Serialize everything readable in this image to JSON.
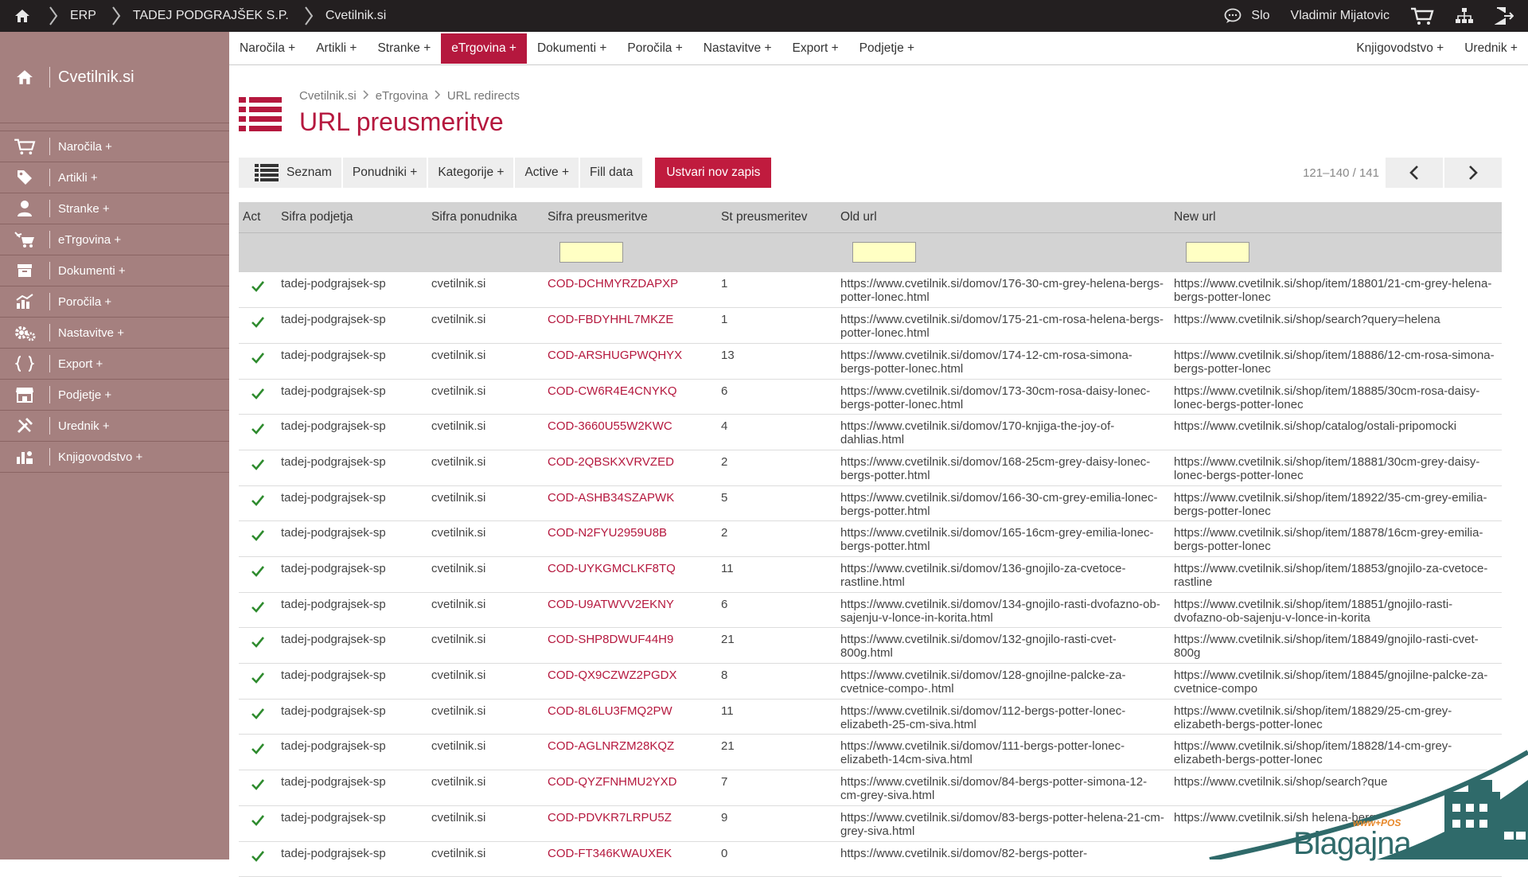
{
  "topbar": {
    "breadcrumb": [
      "ERP",
      "TADEJ PODGRAJŠEK S.P.",
      "Cvetilnik.si"
    ],
    "language": "Slo",
    "user": "Vladimir Mijatovic"
  },
  "sidebar": {
    "title": "Cvetilnik.si",
    "items": [
      {
        "label": "Naročila +",
        "icon": "cart-icon"
      },
      {
        "label": "Artikli +",
        "icon": "tag-icon"
      },
      {
        "label": "Stranke +",
        "icon": "user-icon"
      },
      {
        "label": "eTrgovina +",
        "icon": "ecommerce-icon"
      },
      {
        "label": "Dokumenti +",
        "icon": "documents-icon"
      },
      {
        "label": "Poročila +",
        "icon": "chart-icon"
      },
      {
        "label": "Nastavitve +",
        "icon": "gears-icon"
      },
      {
        "label": "Export +",
        "icon": "export-icon"
      },
      {
        "label": "Podjetje +",
        "icon": "store-icon"
      },
      {
        "label": "Urednik +",
        "icon": "tools-icon"
      },
      {
        "label": "Knjigovodstvo +",
        "icon": "accounting-icon"
      }
    ]
  },
  "menu": {
    "left": [
      "Naročila +",
      "Artikli +",
      "Stranke +",
      "eTrgovina +",
      "Dokumenti +",
      "Poročila +",
      "Nastavitve +",
      "Export +",
      "Podjetje +"
    ],
    "right": [
      "Knjigovodstvo +",
      "Urednik +"
    ],
    "active": "eTrgovina +"
  },
  "page": {
    "breadcrumb": [
      "Cvetilnik.si",
      "eTrgovina",
      "URL redirects"
    ],
    "title": "URL preusmeritve"
  },
  "toolbar": {
    "list": "Seznam",
    "suppliers": "Ponudniki +",
    "categories": "Kategorije +",
    "active": "Active +",
    "fill": "Fill data",
    "create": "Ustvari nov zapis",
    "pager": "121–140 / 141"
  },
  "table": {
    "headers": [
      "Act",
      "Sifra podjetja",
      "Sifra ponudnika",
      "Sifra preusmeritve",
      "St preusmeritev",
      "Old url",
      "New url"
    ],
    "rows": [
      [
        "tadej-podgrajsek-sp",
        "cvetilnik.si",
        "COD-DCHMYRZDAPXP",
        "1",
        "https://www.cvetilnik.si/domov/176-30-cm-grey-helena-bergs-potter-lonec.html",
        "https://www.cvetilnik.si/shop/item/18801/21-cm-grey-helena-bergs-potter-lonec"
      ],
      [
        "tadej-podgrajsek-sp",
        "cvetilnik.si",
        "COD-FBDYHHL7MKZE",
        "1",
        "https://www.cvetilnik.si/domov/175-21-cm-rosa-helena-bergs-potter-lonec.html",
        "https://www.cvetilnik.si/shop/search?query=helena"
      ],
      [
        "tadej-podgrajsek-sp",
        "cvetilnik.si",
        "COD-ARSHUGPWQHYX",
        "13",
        "https://www.cvetilnik.si/domov/174-12-cm-rosa-simona-bergs-potter-lonec.html",
        "https://www.cvetilnik.si/shop/item/18886/12-cm-rosa-simona-bergs-potter-lonec"
      ],
      [
        "tadej-podgrajsek-sp",
        "cvetilnik.si",
        "COD-CW6R4E4CNYKQ",
        "6",
        "https://www.cvetilnik.si/domov/173-30cm-rosa-daisy-lonec-bergs-potter-lonec.html",
        "https://www.cvetilnik.si/shop/item/18885/30cm-rosa-daisy-lonec-bergs-potter-lonec"
      ],
      [
        "tadej-podgrajsek-sp",
        "cvetilnik.si",
        "COD-3660U55W2KWC",
        "4",
        "https://www.cvetilnik.si/domov/170-knjiga-the-joy-of-dahlias.html",
        "https://www.cvetilnik.si/shop/catalog/ostali-pripomocki"
      ],
      [
        "tadej-podgrajsek-sp",
        "cvetilnik.si",
        "COD-2QBSKXVRVZED",
        "2",
        "https://www.cvetilnik.si/domov/168-25cm-grey-daisy-lonec-bergs-potter.html",
        "https://www.cvetilnik.si/shop/item/18881/30cm-grey-daisy-lonec-bergs-potter-lonec"
      ],
      [
        "tadej-podgrajsek-sp",
        "cvetilnik.si",
        "COD-ASHB34SZAPWK",
        "5",
        "https://www.cvetilnik.si/domov/166-30-cm-grey-emilia-lonec-bergs-potter.html",
        "https://www.cvetilnik.si/shop/item/18922/35-cm-grey-emilia-bergs-potter-lonec"
      ],
      [
        "tadej-podgrajsek-sp",
        "cvetilnik.si",
        "COD-N2FYU2959U8B",
        "2",
        "https://www.cvetilnik.si/domov/165-16cm-grey-emilia-lonec-bergs-potter.html",
        "https://www.cvetilnik.si/shop/item/18878/16cm-grey-emilia-bergs-potter-lonec"
      ],
      [
        "tadej-podgrajsek-sp",
        "cvetilnik.si",
        "COD-UYKGMCLKF8TQ",
        "11",
        "https://www.cvetilnik.si/domov/136-gnojilo-za-cvetoce-rastline.html",
        "https://www.cvetilnik.si/shop/item/18853/gnojilo-za-cvetoce-rastline"
      ],
      [
        "tadej-podgrajsek-sp",
        "cvetilnik.si",
        "COD-U9ATWVV2EKNY",
        "6",
        "https://www.cvetilnik.si/domov/134-gnojilo-rasti-dvofazno-ob-sajenju-v-lonce-in-korita.html",
        "https://www.cvetilnik.si/shop/item/18851/gnojilo-rasti-dvofazno-ob-sajenju-v-lonce-in-korita"
      ],
      [
        "tadej-podgrajsek-sp",
        "cvetilnik.si",
        "COD-SHP8DWUF44H9",
        "21",
        "https://www.cvetilnik.si/domov/132-gnojilo-rasti-cvet-800g.html",
        "https://www.cvetilnik.si/shop/item/18849/gnojilo-rasti-cvet-800g"
      ],
      [
        "tadej-podgrajsek-sp",
        "cvetilnik.si",
        "COD-QX9CZWZ2PGDX",
        "8",
        "https://www.cvetilnik.si/domov/128-gnojilne-palcke-za-cvetnice-compo-.html",
        "https://www.cvetilnik.si/shop/item/18845/gnojilne-palcke-za-cvetnice-compo"
      ],
      [
        "tadej-podgrajsek-sp",
        "cvetilnik.si",
        "COD-8L6LU3FMQ2PW",
        "11",
        "https://www.cvetilnik.si/domov/112-bergs-potter-lonec-elizabeth-25-cm-siva.html",
        "https://www.cvetilnik.si/shop/item/18829/25-cm-grey-elizabeth-bergs-potter-lonec"
      ],
      [
        "tadej-podgrajsek-sp",
        "cvetilnik.si",
        "COD-AGLNRZM28KQZ",
        "21",
        "https://www.cvetilnik.si/domov/111-bergs-potter-lonec-elizabeth-14cm-siva.html",
        "https://www.cvetilnik.si/shop/item/18828/14-cm-grey-elizabeth-bergs-potter-lonec"
      ],
      [
        "tadej-podgrajsek-sp",
        "cvetilnik.si",
        "COD-QYZFNHMU2YXD",
        "7",
        "https://www.cvetilnik.si/domov/84-bergs-potter-simona-12-cm-grey-siva.html",
        "https://www.cvetilnik.si/shop/search?que"
      ],
      [
        "tadej-podgrajsek-sp",
        "cvetilnik.si",
        "COD-PDVKR7LRPU5Z",
        "9",
        "https://www.cvetilnik.si/domov/83-bergs-potter-helena-21-cm-grey-siva.html",
        "https://www.cvetilnik.si/sh helena-bergs-po"
      ],
      [
        "tadej-podgrajsek-sp",
        "cvetilnik.si",
        "COD-FT346KWAUXEK",
        "0",
        "https://www.cvetilnik.si/domov/82-bergs-potter-",
        ""
      ]
    ]
  },
  "logo": {
    "small": "www+POS",
    "name": "Blagajna"
  },
  "colors": {
    "accent": "#b5183e",
    "sidebar": "#a5807f",
    "topbar": "#231f20",
    "filter": "#ffffc4",
    "check": "#2e8b2e"
  }
}
